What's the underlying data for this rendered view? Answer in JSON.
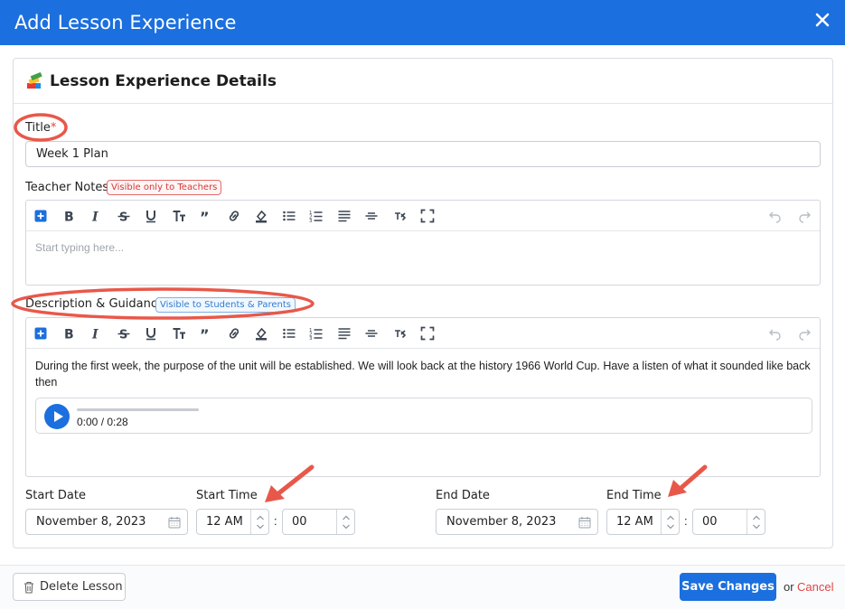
{
  "header": {
    "title": "Add Lesson Experience"
  },
  "card": {
    "title": "Lesson Experience Details"
  },
  "title_field": {
    "label": "Title",
    "required_mark": "*",
    "value": "Week 1 Plan"
  },
  "teacher_notes": {
    "label": "Teacher Notes",
    "badge": "Visible only to Teachers",
    "placeholder": "Start typing here..."
  },
  "description": {
    "label": "Description & Guidance",
    "badge": "Visible to Students & Parents",
    "text": "During the first week, the purpose of the unit will be established. We will look back at the history 1966 World Cup. Have a listen of what it sounded like back then",
    "audio_time": "0:00 / 0:28"
  },
  "schedule": {
    "start_date_label": "Start Date",
    "start_date": "November 8, 2023",
    "start_time_label": "Start Time",
    "start_hour": "12 AM",
    "start_minute": "00",
    "end_date_label": "End Date",
    "end_date": "November 8, 2023",
    "end_time_label": "End Time",
    "end_hour": "12 AM",
    "end_minute": "00",
    "separator": ":"
  },
  "footer": {
    "delete_label": "Delete Lesson",
    "save_label": "Save Changes",
    "or_text": "or",
    "cancel_label": "Cancel"
  },
  "colors": {
    "brand": "#1b6fde",
    "annotation": "#e8584a",
    "required": "#e04545"
  }
}
